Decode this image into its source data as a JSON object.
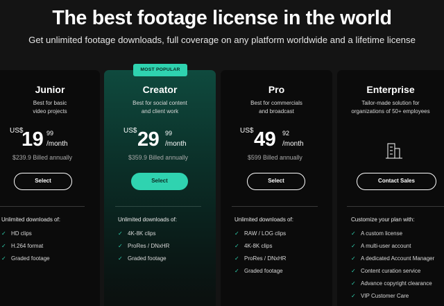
{
  "hero": {
    "title": "The best footage license in the world",
    "subtitle": "Get unlimited footage downloads, full coverage on any platform worldwide and a lifetime license"
  },
  "accent_color": "#2fd3b0",
  "plans": [
    {
      "name": "Junior",
      "desc_line1": "Best for basic",
      "desc_line2": "video projects",
      "currency": "US$",
      "price_main": "19",
      "price_cents": "99",
      "period": "/month",
      "billed": "$239.9 Billed annually",
      "cta": "Select",
      "features_heading": "Unlimited downloads of:",
      "features": [
        "HD clips",
        "H.264 format",
        "Graded footage"
      ]
    },
    {
      "name": "Creator",
      "badge": "MOST POPULAR",
      "desc_line1": "Best for social content",
      "desc_line2": "and client work",
      "currency": "US$",
      "price_main": "29",
      "price_cents": "99",
      "period": "/month",
      "billed": "$359.9 Billed annually",
      "cta": "Select",
      "features_heading": "Unlimited downloads of:",
      "features": [
        "4K-8K clips",
        "ProRes / DNxHR",
        "Graded footage"
      ]
    },
    {
      "name": "Pro",
      "desc_line1": "Best for commercials",
      "desc_line2": "and broadcast",
      "currency": "US$",
      "price_main": "49",
      "price_cents": "92",
      "period": "/month",
      "billed": "$599 Billed annually",
      "cta": "Select",
      "features_heading": "Unlimited downloads of:",
      "features": [
        "RAW / LOG clips",
        "4K-8K clips",
        "ProRes / DNxHR",
        "Graded footage"
      ]
    },
    {
      "name": "Enterprise",
      "desc_line1": "Tailor-made solution for",
      "desc_line2": "organizations of 50+ employees",
      "icon": "building-icon",
      "cta": "Contact Sales",
      "features_heading": "Customize your plan with:",
      "features": [
        "A custom license",
        "A multi-user account",
        "A dedicated Account Manager",
        "Content curation service",
        "Advance copyright clearance",
        "VIP Customer Care"
      ]
    }
  ]
}
